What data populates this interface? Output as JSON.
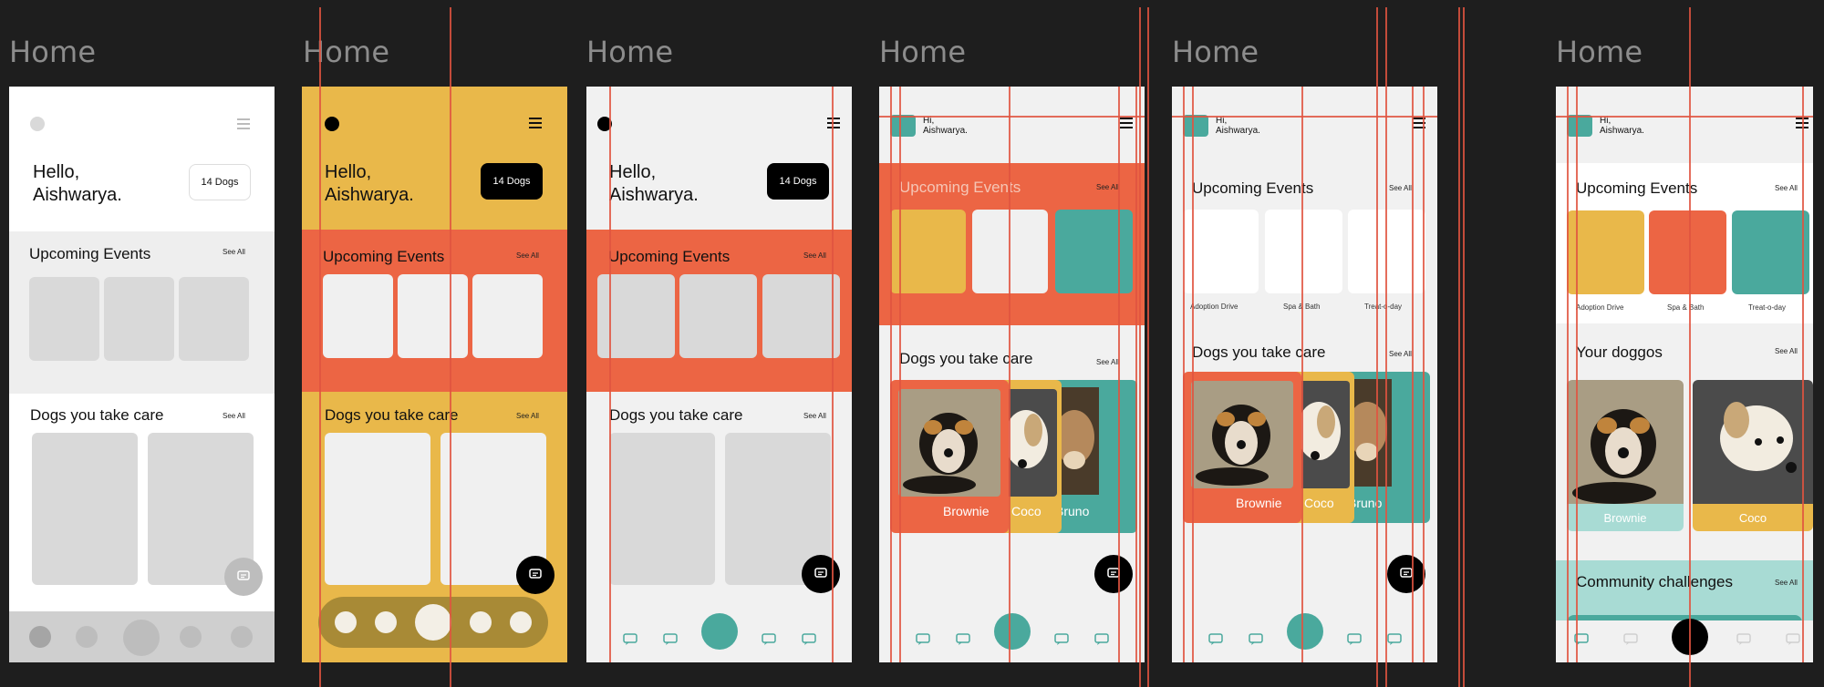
{
  "frame_title": "Home",
  "greeting": "Hello,\nAishwarya.",
  "greeting_short": "Hi,\nAishwarya.",
  "dogs_badge": "14 Dogs",
  "upcoming_events": "Upcoming Events",
  "see_all": "See All",
  "dogs_section": "Dogs you take care",
  "your_doggos": "Your doggos",
  "community": "Community challenges",
  "events": [
    "Adoption Drive",
    "Spa & Bath",
    "Treat-o-day"
  ],
  "dogs": [
    "Brownie",
    "Coco",
    "Bruno"
  ],
  "dogs_truncated": "Bruno",
  "colors": {
    "canvas": "#1e1e1e",
    "title_gray": "#8c8c8c",
    "yellow": "#e9b84a",
    "orange": "#ec6544",
    "teal": "#4aa99d",
    "light_teal": "#a8dbd4",
    "guide_red": "#e0533f",
    "wire_gray": "#d9d9d9"
  }
}
